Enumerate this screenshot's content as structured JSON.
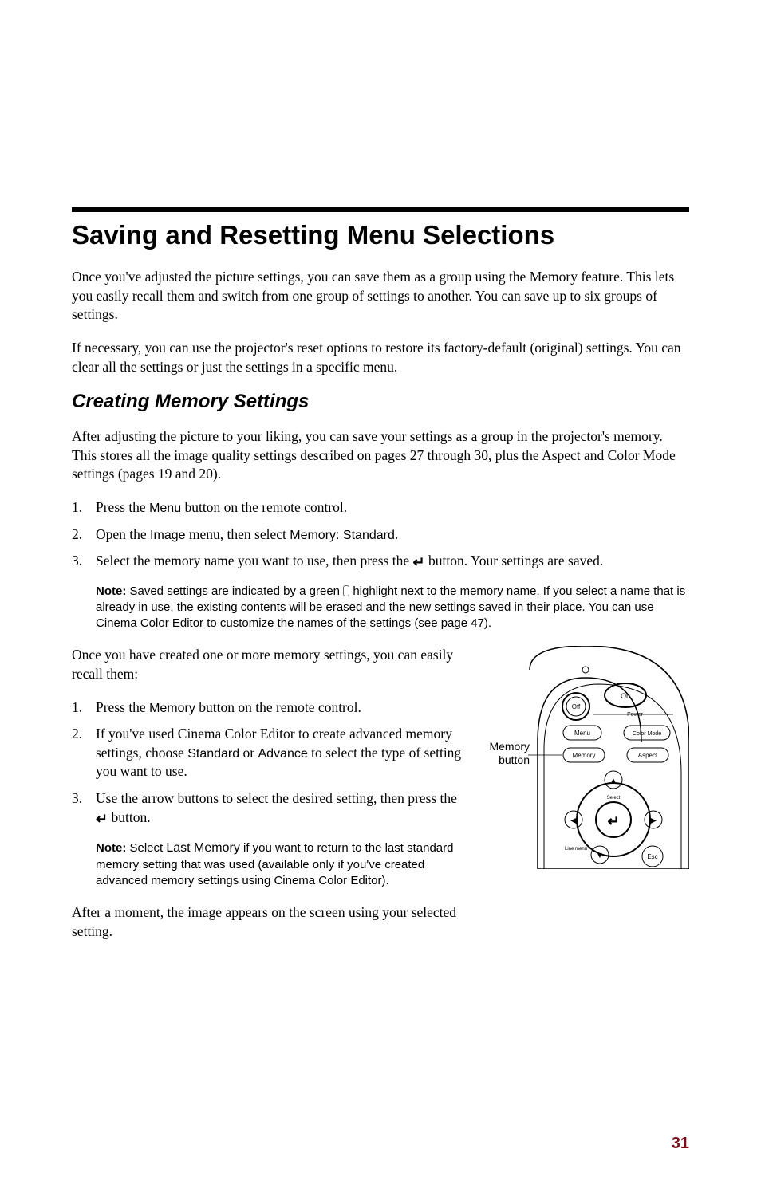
{
  "title": "Saving and Resetting Menu Selections",
  "intro1": "Once you've adjusted the picture settings, you can save them as a group using the Memory feature. This lets you easily recall them and switch from one group of settings to another. You can save up to six groups of settings.",
  "intro2": "If necessary, you can use the projector's reset options to restore its factory-default (original) settings. You can clear all the settings or just the settings in a specific menu.",
  "section1_title": "Creating Memory Settings",
  "section1_intro": "After adjusting the picture to your liking, you can save your settings as a group in the projector's memory. This stores all the image quality settings described on pages 27 through 30, plus the Aspect and Color Mode settings (pages 19 and 20).",
  "listA": {
    "i1_pre": "Press the ",
    "i1_btn": "Menu",
    "i1_post": " button on the remote control.",
    "i2_pre": "Open the ",
    "i2_m1": "Image",
    "i2_mid": " menu, then select ",
    "i2_m2": "Memory: Standard",
    "i2_post": ".",
    "i3_pre": "Select the memory name you want to use, then press the ",
    "i3_post": " button. Your settings are saved."
  },
  "note1": {
    "label": "Note:",
    "pre": " Saved settings are indicated by a green ",
    "post": " highlight next to the memory name. If you select a name that is already in use, the existing contents will be erased and the new settings saved in their place. You can use Cinema Color Editor to customize the names of the settings (see page 47)."
  },
  "between": "Once you have created one or more memory settings, you can easily recall them:",
  "listB": {
    "i1_pre": "Press the ",
    "i1_btn": "Memory",
    "i1_post": " button on the remote control.",
    "i2_pre": "If you've used Cinema Color Editor to create advanced memory settings, choose ",
    "i2_b1": "Standard",
    "i2_mid": " or ",
    "i2_b2": "Advance",
    "i2_post": " to select the type of setting you want to use.",
    "i3_pre": "Use the arrow buttons to select the desired setting, then press the ",
    "i3_post": " button."
  },
  "note2": {
    "label": "Note:",
    "pre": " Select ",
    "btn": "Last Memory",
    "post": " if you want to return to the last standard memory setting that was used (available only if you've created advanced memory settings using Cinema Color Editor)."
  },
  "closing": "After a moment, the image appears on the screen using your selected setting.",
  "callout_l1": "Memory",
  "callout_l2": "button",
  "remote": {
    "on": "On",
    "off": "Off",
    "power": "Power",
    "menu": "Menu",
    "colormode": "Color Mode",
    "memory": "Memory",
    "aspect": "Aspect",
    "select": "Select",
    "linemenu": "Line menu",
    "esc": "Esc"
  },
  "page_number": "31"
}
